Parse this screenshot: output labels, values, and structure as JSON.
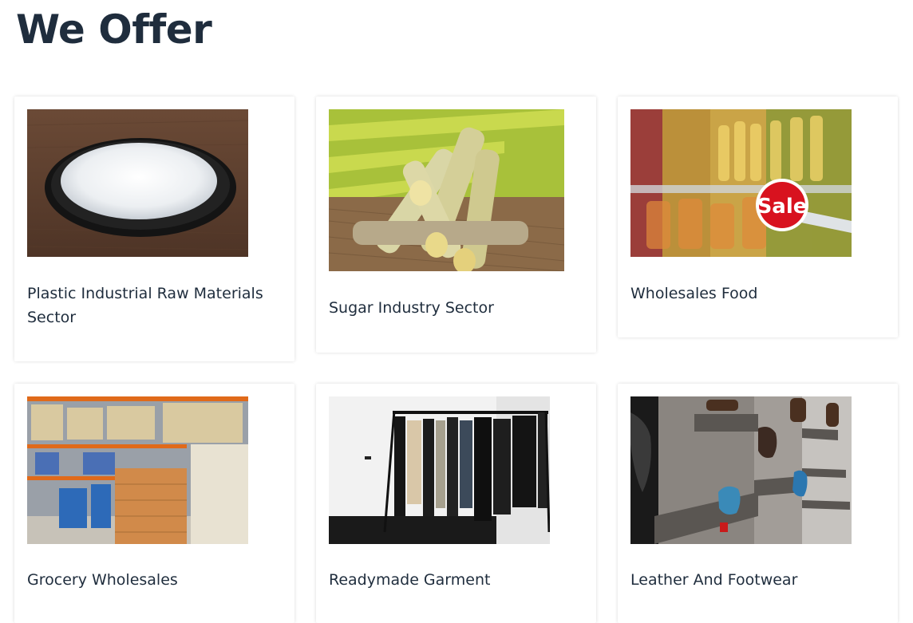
{
  "page": {
    "title": "We Offer"
  },
  "offers": [
    {
      "title": "Plastic Industrial Raw Materials Sector",
      "image": "plastic-granules-plate"
    },
    {
      "title": "Sugar Industry Sector",
      "image": "sugarcane-stalks"
    },
    {
      "title": "Wholesales Food",
      "image": "supermarket-shelf-sale-sign",
      "sale_sign_text": "Sale"
    },
    {
      "title": "Grocery Wholesales",
      "image": "warehouse-store-aisle"
    },
    {
      "title": "Readymade Garment",
      "image": "clothing-rack"
    },
    {
      "title": "Leather And Footwear",
      "image": "shoe-display-wall"
    }
  ],
  "colors": {
    "heading": "#1f2d3d",
    "card_bg": "#ffffff",
    "sale_red": "#d8121f"
  }
}
